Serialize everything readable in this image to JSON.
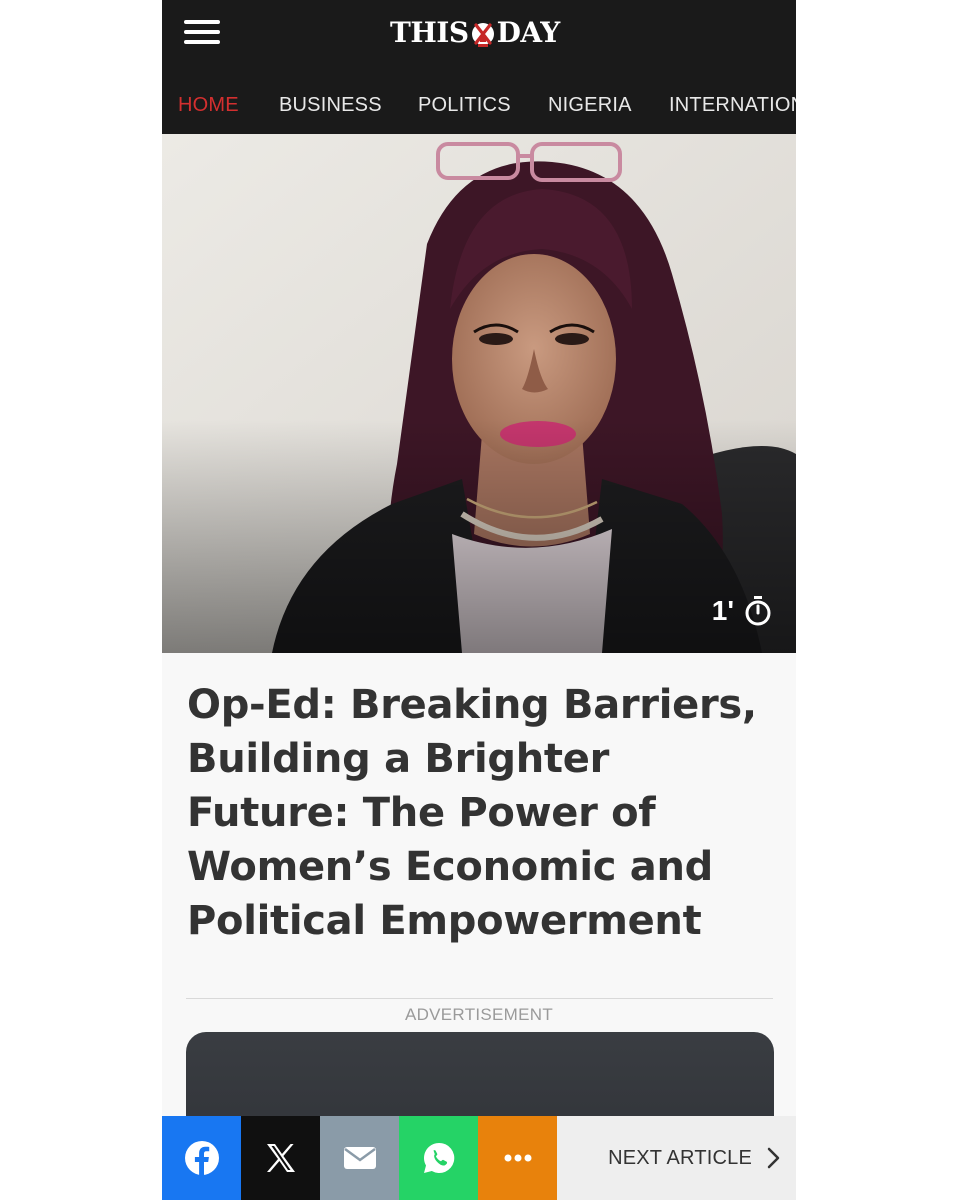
{
  "header": {
    "logo_left": "THIS",
    "logo_right": "DAY",
    "menu_icon": "hamburger-menu-icon"
  },
  "nav": {
    "items": [
      {
        "label": "HOME",
        "active": true
      },
      {
        "label": "BUSINESS",
        "active": false
      },
      {
        "label": "POLITICS",
        "active": false
      },
      {
        "label": "NIGERIA",
        "active": false
      },
      {
        "label": "INTERNATION",
        "active": false
      }
    ],
    "active_color": "#d32f2f"
  },
  "hero": {
    "read_time": "1'",
    "read_time_icon": "stopwatch-icon"
  },
  "article": {
    "title": "Op-Ed: Breaking Barriers, Building a Brighter Future: The Power of Women’s Economic and Political Empowerment"
  },
  "ad": {
    "label": "ADVERTISEMENT"
  },
  "share_bar": {
    "buttons": [
      {
        "icon": "facebook-icon",
        "color": "#1877f2"
      },
      {
        "icon": "x-icon",
        "color": "#101010"
      },
      {
        "icon": "mail-icon",
        "color": "#8a9ba8"
      },
      {
        "icon": "whatsapp-icon",
        "color": "#25d366"
      },
      {
        "icon": "more-icon",
        "color": "#e8820c"
      }
    ],
    "next_label": "NEXT ARTICLE"
  }
}
